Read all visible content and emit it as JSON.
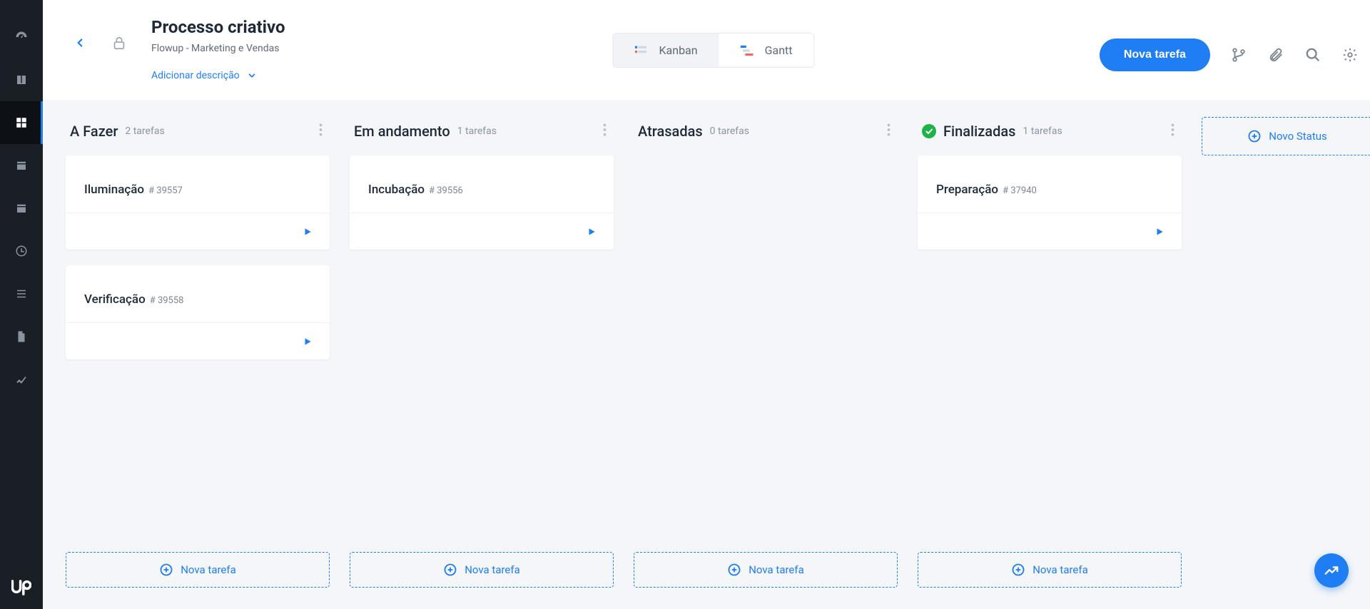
{
  "header": {
    "title": "Processo criativo",
    "breadcrumb": "Flowup - Marketing e Vendas",
    "add_description": "Adicionar descrição",
    "new_task_button": "Nova tarefa"
  },
  "view_tabs": {
    "kanban": "Kanban",
    "gantt": "Gantt"
  },
  "board": {
    "new_status_label": "Novo Status",
    "new_task_label": "Nova tarefa",
    "columns": [
      {
        "title": "A Fazer",
        "count_label": "2 tarefas",
        "done": false,
        "cards": [
          {
            "title": "Iluminação",
            "id": "# 39557"
          },
          {
            "title": "Verificação",
            "id": "# 39558"
          }
        ]
      },
      {
        "title": "Em andamento",
        "count_label": "1 tarefas",
        "done": false,
        "cards": [
          {
            "title": "Incubação",
            "id": "# 39556"
          }
        ]
      },
      {
        "title": "Atrasadas",
        "count_label": "0 tarefas",
        "done": false,
        "cards": []
      },
      {
        "title": "Finalizadas",
        "count_label": "1 tarefas",
        "done": true,
        "cards": [
          {
            "title": "Preparação",
            "id": "# 37940"
          }
        ]
      }
    ]
  },
  "icons": {
    "back": "chevron-left",
    "lock": "lock",
    "branch": "git-branch",
    "attachment": "paperclip",
    "search": "search",
    "settings": "gear",
    "kanban": "kanban",
    "gantt": "gantt",
    "play": "play",
    "plus": "plus-circle",
    "check": "check",
    "dots": "dots-vertical",
    "fab": "chart-line"
  },
  "sidebar": {
    "items": [
      {
        "name": "dashboard-icon"
      },
      {
        "name": "book-icon"
      },
      {
        "name": "grid-icon",
        "active": true
      },
      {
        "name": "calendar-range-icon"
      },
      {
        "name": "calendar-icon"
      },
      {
        "name": "clock-icon"
      },
      {
        "name": "list-icon"
      },
      {
        "name": "document-icon"
      },
      {
        "name": "chart-icon"
      }
    ],
    "logo": "Up"
  }
}
